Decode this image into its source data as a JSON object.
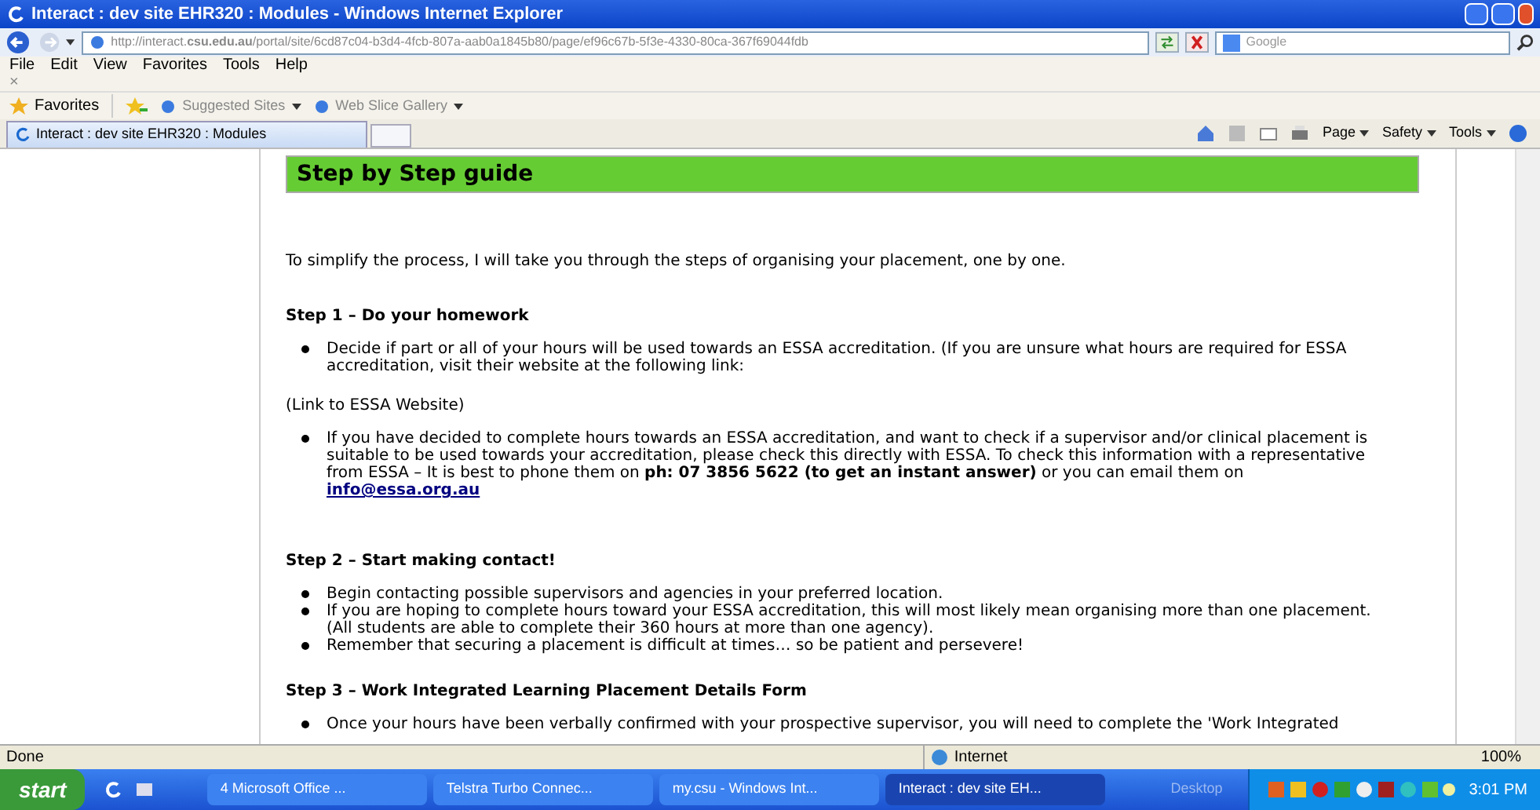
{
  "window": {
    "title": "Interact : dev site EHR320 : Modules - Windows Internet Explorer"
  },
  "address_bar": {
    "url": "http://interact.**csu.edu.au**/portal/site/6cd87c04-b3d4-4fcb-807a-aab0a1845b80/page/ef96c67b-5f3e-4330-80ca-367f69044fdb",
    "search_placeholder": "Google"
  },
  "menu": [
    "File",
    "Edit",
    "View",
    "Favorites",
    "Tools",
    "Help"
  ],
  "close_glyph": "×",
  "favorites_bar": {
    "favorites": "Favorites",
    "links": [
      "Suggested Sites",
      "Web Slice Gallery"
    ]
  },
  "tabs": [
    {
      "label": "Interact : dev site EHR320 : Modules",
      "selected": true
    },
    {
      "selected": false
    }
  ],
  "command_bar": [
    "Page",
    "Safety",
    "Tools"
  ],
  "page": {
    "heading": "Step by Step guide",
    "intro": "To simplify the process, I will take you through the steps of organising your placement, one by one.",
    "sections": [
      {
        "title": "Step 1 – Do your homework",
        "blocks": [
          {
            "kind": "bullets",
            "items": [
              {
                "text": "Decide if part or all of your hours will be used towards an ESSA accreditation. (If you are unsure what hours are required for ESSA accreditation, visit their website at the following link:"
              }
            ]
          },
          {
            "kind": "para",
            "text": "(Link to ESSA Website)"
          },
          {
            "kind": "bullets",
            "items": [
              {
                "text": "If you have decided to complete hours towards an ESSA accreditation, and want to check if a supervisor and/or clinical placement is suitable to be used towards your accreditation, please check this directly with ESSA.  To check this information with a representative from ESSA – It is best to phone them on **ph: 07 3856 5622 (to get an instant answer)** or you can email them on",
                "link": "info@essa.org.au"
              }
            ]
          }
        ]
      },
      {
        "title": "Step 2 – Start making contact!",
        "blocks": [
          {
            "kind": "bullets",
            "items": [
              {
                "text": "Begin contacting possible supervisors and agencies in your preferred location."
              },
              {
                "text": "If you are hoping to complete hours toward your ESSA accreditation, this will most likely mean organising more than one placement. (All students are able to complete their 360 hours at more than one agency)."
              },
              {
                "text": "Remember that securing a placement is difficult at times… so be patient and persevere!"
              }
            ]
          }
        ]
      },
      {
        "title": "Step 3 – Work Integrated Learning Placement Details Form",
        "blocks": [
          {
            "kind": "bullets",
            "items": [
              {
                "text": "Once your hours have been verbally confirmed with your prospective supervisor, you will need to complete the 'Work Integrated"
              }
            ]
          }
        ]
      }
    ]
  },
  "status_bar": {
    "status": "Done",
    "zone": "Internet",
    "zoom": "100%"
  },
  "taskbar": {
    "start": "start",
    "buttons": [
      {
        "label": "4 Microsoft Office ...",
        "selected": false
      },
      {
        "label": "Telstra Turbo Connec...",
        "selected": false
      },
      {
        "label": "my.csu - Windows Int...",
        "selected": false
      },
      {
        "label": "Interact : dev site EH...",
        "selected": true
      }
    ],
    "desktop": "Desktop",
    "clock": "3:01 PM"
  }
}
